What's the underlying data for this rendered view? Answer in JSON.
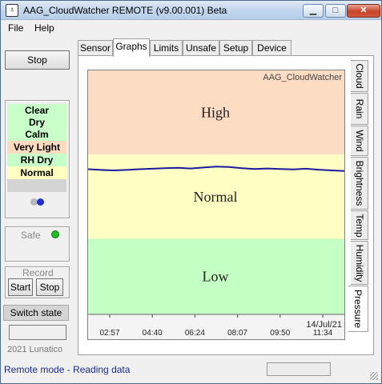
{
  "window": {
    "title": "AAG_CloudWatcher REMOTE (v9.00.001) Beta"
  },
  "menu": {
    "items": [
      "File",
      "Help"
    ]
  },
  "left": {
    "stop_label": "Stop",
    "status_rows": [
      {
        "text": "Clear",
        "color": "#c8ffc8"
      },
      {
        "text": "Dry",
        "color": "#c8ffc8"
      },
      {
        "text": "Calm",
        "color": "#c8ffc8"
      },
      {
        "text": "Very Light",
        "color": "#ffdcc0"
      },
      {
        "text": "RH Dry",
        "color": "#c8ffc8"
      },
      {
        "text": "Normal",
        "color": "#ffffc0"
      },
      {
        "text": "",
        "color": "#d4d4d4"
      }
    ],
    "dot_colors": [
      "#b8b8b8",
      "#1f2fd1"
    ],
    "safe_label": "Safe",
    "safe_color": "#22bb22",
    "record_label": "Record",
    "record_start": "Start",
    "record_stop": "Stop",
    "switch_state": "Switch state",
    "copyright": "2021 Lunatico"
  },
  "tabs": {
    "items": [
      "Sensor",
      "Graphs",
      "Limits",
      "Unsafe",
      "Setup",
      "Device"
    ],
    "active": "Graphs"
  },
  "side_tabs": {
    "items": [
      "Cloud",
      "Rain",
      "Wind",
      "Brightness",
      "Temp",
      "Humidity",
      "Pressure"
    ],
    "active": "Pressure"
  },
  "chart_data": {
    "type": "line",
    "watermark": "AAG_CloudWatcher",
    "date_label": "14/Jul/21",
    "x_ticks": [
      "02:57",
      "04:40",
      "06:24",
      "08:07",
      "09:50",
      "11:34"
    ],
    "bands": [
      {
        "label": "High",
        "color": "#fddcc4"
      },
      {
        "label": "Normal",
        "color": "#ffffc4"
      },
      {
        "label": "Low",
        "color": "#c4ffc4"
      }
    ],
    "band_fractions": [
      0.345,
      0.345,
      0.31
    ],
    "series": [
      {
        "color": "#1a1aa0",
        "x_frac": [
          0.0,
          0.05,
          0.1,
          0.15,
          0.2,
          0.25,
          0.3,
          0.35,
          0.4,
          0.45,
          0.5,
          0.55,
          0.6,
          0.65,
          0.7,
          0.75,
          0.8,
          0.85,
          0.9,
          0.95,
          1.0
        ],
        "y_frac": [
          0.405,
          0.408,
          0.41,
          0.408,
          0.405,
          0.403,
          0.401,
          0.399,
          0.402,
          0.398,
          0.394,
          0.396,
          0.401,
          0.404,
          0.402,
          0.404,
          0.406,
          0.403,
          0.407,
          0.41,
          0.412
        ]
      }
    ]
  },
  "statusbar": {
    "text": "Remote mode - Reading data"
  }
}
